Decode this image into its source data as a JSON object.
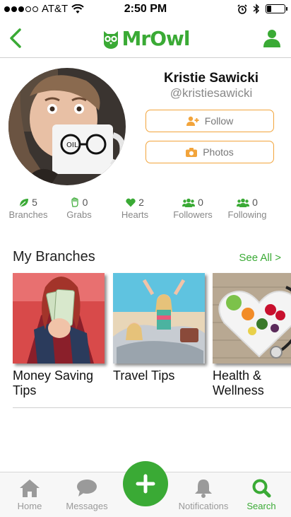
{
  "status_bar": {
    "carrier": "AT&T",
    "time": "2:50 PM",
    "battery_level": 0.28
  },
  "nav": {
    "logo_text": "MrOwl"
  },
  "profile": {
    "name": "Kristie Sawicki",
    "handle": "@kristiesawicki",
    "follow_label": "Follow",
    "photos_label": "Photos"
  },
  "stats": [
    {
      "count": "5",
      "label": "Branches",
      "icon": "leaf-icon"
    },
    {
      "count": "0",
      "label": "Grabs",
      "icon": "grab-hand-icon"
    },
    {
      "count": "2",
      "label": "Hearts",
      "icon": "heart-icon"
    },
    {
      "count": "0",
      "label": "Followers",
      "icon": "followers-icon"
    },
    {
      "count": "0",
      "label": "Following",
      "icon": "following-icon"
    }
  ],
  "branches": {
    "title": "My Branches",
    "see_all": "See All >",
    "items": [
      {
        "title": "Money Saving Tips"
      },
      {
        "title": "Travel Tips"
      },
      {
        "title": "Health & Wellness"
      }
    ]
  },
  "tabs": [
    {
      "label": "Home",
      "icon": "home-icon"
    },
    {
      "label": "Messages",
      "icon": "messages-icon"
    },
    {
      "label": "Notifications",
      "icon": "bell-icon"
    },
    {
      "label": "Search",
      "icon": "search-icon",
      "active": true
    }
  ],
  "colors": {
    "brand_green": "#3aaa35",
    "accent_orange": "#f2a43b"
  }
}
